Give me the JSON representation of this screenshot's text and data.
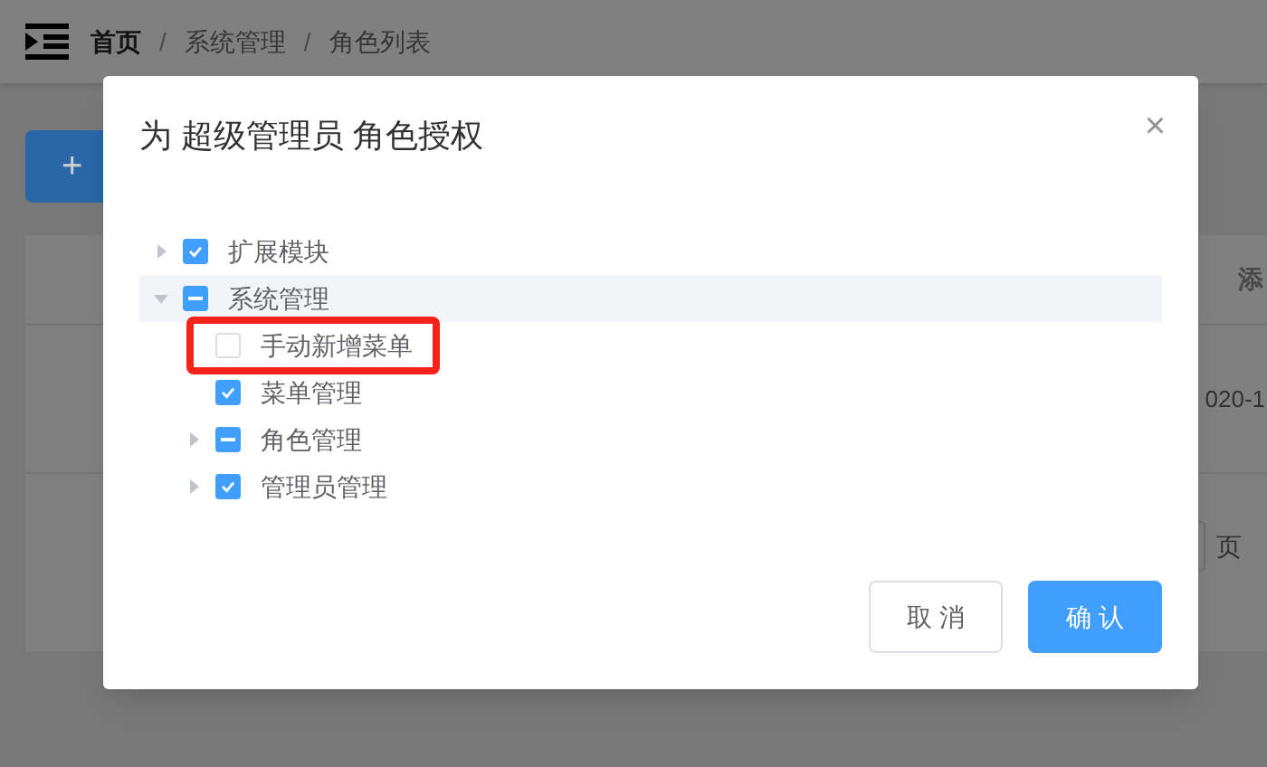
{
  "breadcrumb": [
    {
      "label": "首页",
      "current": false
    },
    {
      "label": "系统管理",
      "current": true
    },
    {
      "label": "角色列表",
      "current": true
    }
  ],
  "breadcrumb_separator": "/",
  "toolbar": {
    "add_button": "+"
  },
  "table": {
    "column_1": "添",
    "cell": "020-1"
  },
  "pagination": {
    "page_unit": "页"
  },
  "dialog": {
    "title": "为 超级管理员 角色授权",
    "close": "×",
    "tree": [
      {
        "label": "扩展模块",
        "checked": true,
        "indeterminate": false,
        "expanded": false,
        "highlighted": false,
        "annotated": false
      },
      {
        "label": "系统管理",
        "checked": false,
        "indeterminate": true,
        "expanded": true,
        "highlighted": true,
        "annotated": false,
        "children": [
          {
            "label": "手动新增菜单",
            "checked": false,
            "indeterminate": false,
            "highlighted": false,
            "annotated": true
          },
          {
            "label": "菜单管理",
            "checked": true,
            "indeterminate": false,
            "highlighted": false,
            "annotated": false
          },
          {
            "label": "角色管理",
            "checked": false,
            "indeterminate": true,
            "expanded": false,
            "highlighted": false,
            "annotated": false
          },
          {
            "label": "管理员管理",
            "checked": true,
            "indeterminate": false,
            "expanded": false,
            "highlighted": false,
            "annotated": false
          }
        ]
      }
    ],
    "buttons": [
      {
        "label": "取 消",
        "kind": "secondary"
      },
      {
        "label": "确 认",
        "kind": "primary"
      }
    ]
  }
}
